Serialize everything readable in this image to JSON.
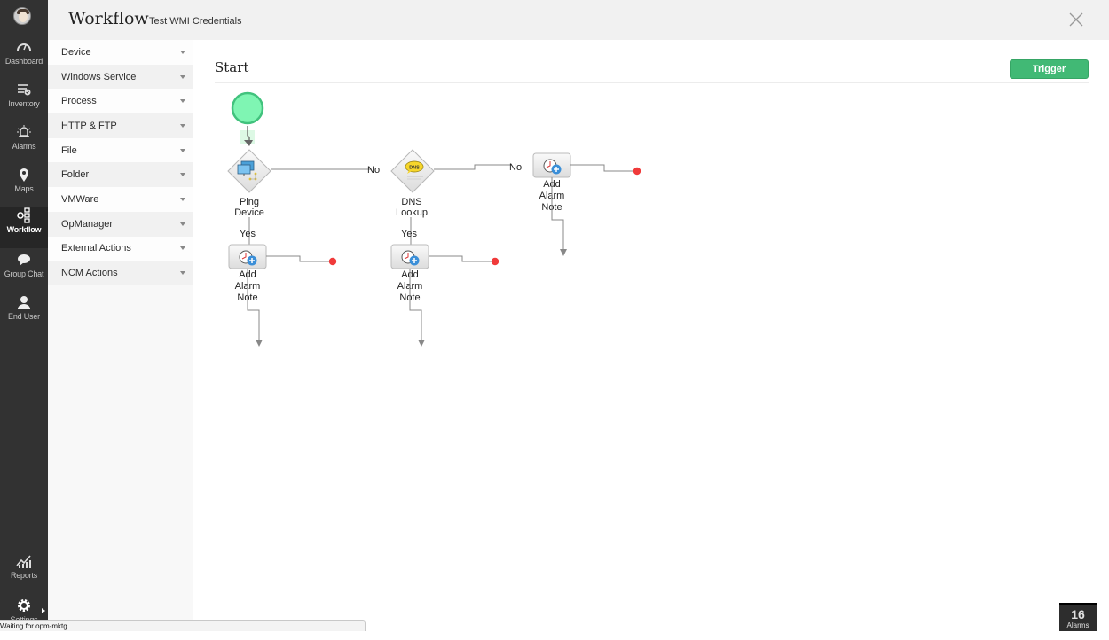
{
  "nav": {
    "items": [
      {
        "label": "Dashboard",
        "icon": "dashboard-gauge-icon"
      },
      {
        "label": "Inventory",
        "icon": "inventory-list-icon"
      },
      {
        "label": "Alarms",
        "icon": "alarm-bell-icon"
      },
      {
        "label": "Maps",
        "icon": "map-pin-icon"
      },
      {
        "label": "Workflow",
        "icon": "workflow-icon",
        "active": true
      },
      {
        "label": "Group Chat",
        "icon": "chat-bubble-icon"
      },
      {
        "label": "End User",
        "icon": "user-icon"
      },
      {
        "label": "Reports",
        "icon": "reports-chart-icon"
      },
      {
        "label": "Settings",
        "icon": "gear-icon"
      }
    ]
  },
  "header": {
    "title": "Workflow",
    "subtitle": "Test WMI Credentials",
    "close_icon": "close-icon"
  },
  "categories": [
    "Device",
    "Windows Service",
    "Process",
    "HTTP & FTP",
    "File",
    "Folder",
    "VMWare",
    "OpManager",
    "External Actions",
    "NCM Actions"
  ],
  "canvas": {
    "heading": "Start",
    "trigger_label": "Trigger",
    "nodes": {
      "ping": {
        "line1": "Ping",
        "line2": "Device"
      },
      "dns": {
        "line1": "DNS",
        "line2": "Lookup",
        "badge": "DNS"
      },
      "note_no": {
        "line1": "Add",
        "line2": "Alarm",
        "line3": "Note"
      },
      "note_yes1": {
        "line1": "Add",
        "line2": "Alarm",
        "line3": "Note"
      },
      "note_yes2": {
        "line1": "Add",
        "line2": "Alarm",
        "line3": "Note"
      }
    },
    "edge_labels": {
      "no1": "No",
      "no2": "No",
      "yes1": "Yes",
      "yes2": "Yes"
    }
  },
  "status_bar": {
    "text": "Waiting for opm-mktg..."
  },
  "alarm_badge": {
    "count": "16",
    "label": "Alarms"
  },
  "colors": {
    "accent_green": "#41b975",
    "start_node": "#7ff5b3",
    "end_dot": "#f03a3a",
    "nav_bg": "#323232"
  }
}
